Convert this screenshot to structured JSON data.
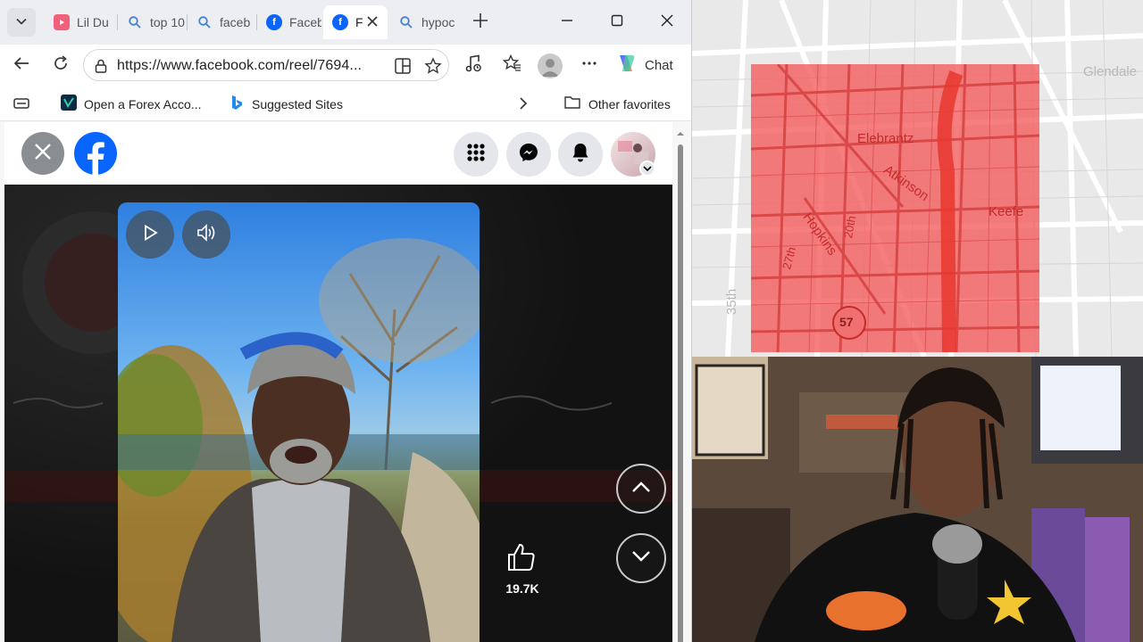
{
  "browser": {
    "tabs": [
      {
        "label": "Lil Du",
        "icon": "youtube-icon"
      },
      {
        "label": "top 10",
        "icon": "search-icon"
      },
      {
        "label": "faceb",
        "icon": "search-icon"
      },
      {
        "label": "Faceb",
        "icon": "facebook-icon"
      },
      {
        "label": "F",
        "icon": "facebook-icon",
        "active": true
      },
      {
        "label": "hypoc",
        "icon": "search-icon"
      }
    ],
    "url": "https://www.facebook.com/reel/7694...",
    "copilot_label": "Chat"
  },
  "favorites": {
    "items": [
      {
        "label": "Open a Forex Acco..."
      },
      {
        "label": "Suggested Sites"
      }
    ],
    "other": "Other favorites"
  },
  "reel": {
    "likes": "19.7K"
  },
  "map": {
    "labels": [
      "Elebrantz",
      "Atkinson",
      "Keefe",
      "Hopkins",
      "27th",
      "20th",
      "57",
      "Glendale",
      "35th"
    ]
  },
  "colors": {
    "facebook_blue": "#0866ff",
    "map_highlight": "#f55a5a"
  }
}
